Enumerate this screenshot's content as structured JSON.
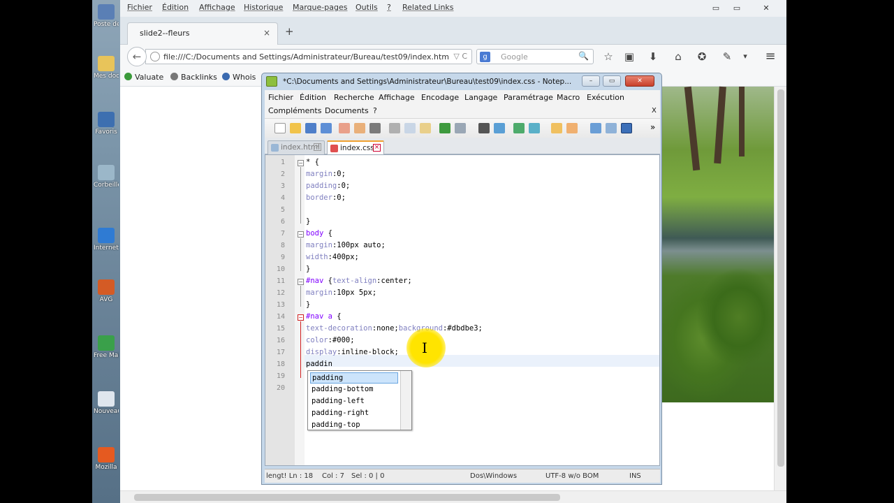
{
  "desktop": {
    "icons": [
      {
        "label": "Poste de",
        "color": "#5a7fb5"
      },
      {
        "label": "Mes docu",
        "color": "#e8c45a"
      },
      {
        "label": "Favoris",
        "color": "#3d6fb0"
      },
      {
        "label": "Corbeille",
        "color": "#9bb7c9"
      },
      {
        "label": "Internet Explorer",
        "color": "#2f7bd3"
      },
      {
        "label": "AVG",
        "color": "#d45b25"
      },
      {
        "label": "Free Mail Gen",
        "color": "#3aa04a"
      },
      {
        "label": "Nouveau Doc",
        "color": "#dfe6ee"
      },
      {
        "label": "Mozilla",
        "color": "#e55a20"
      }
    ]
  },
  "firefox": {
    "menu": [
      "Fichier",
      "Édition",
      "Affichage",
      "Historique",
      "Marque-pages",
      "Outils",
      "?",
      "Related Links"
    ],
    "window_buttons": {
      "minimize": "▭",
      "maximize": "▭",
      "close": "✕"
    },
    "tab": {
      "title": "slide2--fleurs",
      "close": "×"
    },
    "new_tab": "+",
    "back": "←",
    "url": "file:///C:/Documents and Settings/Administrateur/Bureau/test09/index.htm",
    "url_right": "▽ C",
    "search": {
      "engine": "g",
      "placeholder": "Google",
      "button": "🔍"
    },
    "toolbar_icons": [
      "star-icon",
      "clipboard-icon",
      "download-icon",
      "home-icon",
      "addon-icon",
      "tools-icon",
      "menu-icon"
    ],
    "toolbar_glyphs": [
      "☆",
      "▣",
      "⬇",
      "⌂",
      "✪",
      "✎",
      "▾",
      "≡"
    ],
    "bookmarks": [
      {
        "label": "Valuate",
        "color": "#3a9a3a"
      },
      {
        "label": "Backlinks",
        "color": "#666666"
      },
      {
        "label": "Whois",
        "color": "#3a6ab0"
      }
    ]
  },
  "notepad": {
    "title": "*C:\\Documents and Settings\\Administrateur\\Bureau\\test09\\index.css - Notep...",
    "title_buttons": {
      "minimize": "–",
      "maximize": "▭",
      "close": "✕"
    },
    "menu_row1": [
      "Fichier",
      "Édition",
      "Recherche",
      "Affichage",
      "Encodage",
      "Langage",
      "Paramétrage",
      "Macro",
      "Exécution"
    ],
    "menu_row2": [
      "Compléments",
      "Documents",
      "?"
    ],
    "menu_close": "X",
    "toolbar_more": "»",
    "tabs": [
      {
        "label": "index.html",
        "active": false
      },
      {
        "label": "index.css",
        "active": true
      }
    ],
    "lines": [
      {
        "n": "1",
        "html": "<span class='p'>* {</span>"
      },
      {
        "n": "2",
        "html": "<span class='k'>margin</span><span class='p'>:0;</span>"
      },
      {
        "n": "3",
        "html": "<span class='k'>padding</span><span class='p'>:0;</span>"
      },
      {
        "n": "4",
        "html": "<span class='k'>border</span><span class='p'>:0;</span>"
      },
      {
        "n": "5",
        "html": ""
      },
      {
        "n": "6",
        "html": "<span class='p'>}</span>"
      },
      {
        "n": "7",
        "html": "<span class='s'>body</span> <span class='p'>{</span>"
      },
      {
        "n": "8",
        "html": "<span class='k'>margin</span><span class='p'>:100px auto;</span>"
      },
      {
        "n": "9",
        "html": "<span class='k'>width</span><span class='p'>:400px;</span>"
      },
      {
        "n": "10",
        "html": "<span class='p'>}</span>"
      },
      {
        "n": "11",
        "html": "<span class='s'>#nav</span> <span class='p'>{</span><span class='k'>text-align</span><span class='p'>:center;</span>"
      },
      {
        "n": "12",
        "html": "<span class='k'>margin</span><span class='p'>:10px 5px;</span>"
      },
      {
        "n": "13",
        "html": "<span class='p'>}</span>"
      },
      {
        "n": "14",
        "html": "<span class='s'>#nav a</span> <span class='p'>{</span>"
      },
      {
        "n": "15",
        "html": "<span class='k'>text-decoration</span><span class='p'>:none;</span><span class='k'>background</span><span class='p'>:#dbdbe3;</span>"
      },
      {
        "n": "16",
        "html": "<span class='k'>color</span><span class='p'>:#000;</span>"
      },
      {
        "n": "17",
        "html": "<span class='k'>display</span><span class='p'>:inline-block;</span>"
      },
      {
        "n": "18",
        "html": "<span class='p'>paddin</span>"
      },
      {
        "n": "19",
        "html": ""
      },
      {
        "n": "20",
        "html": ""
      }
    ],
    "autocomplete": [
      "padding",
      "padding-bottom",
      "padding-left",
      "padding-right",
      "padding-top"
    ],
    "status": {
      "length": "lengt! Ln : 18",
      "col": "Col : 7",
      "sel": "Sel : 0 | 0",
      "eol": "Dos\\Windows",
      "encoding": "UTF-8 w/o BOM",
      "mode": "INS"
    }
  }
}
